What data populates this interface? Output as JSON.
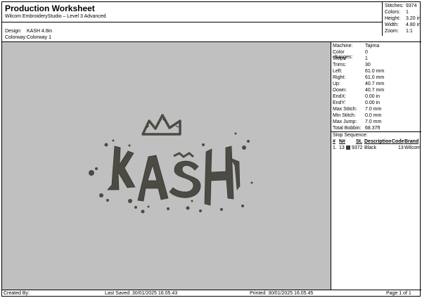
{
  "header": {
    "title": "Production Worksheet",
    "subtitle": "Wilcom EmbroideryStudio – Level 3 Advanced",
    "design_label": "Design:",
    "design_value": "KASH 4.8in",
    "colorway_label": "Colorway:",
    "colorway_value": "Colorway 1"
  },
  "top_stats": [
    {
      "label": "Stitches:",
      "value": "9374"
    },
    {
      "label": "Colors:",
      "value": "1"
    },
    {
      "label": "Height:",
      "value": "3.20 in"
    },
    {
      "label": "Width:",
      "value": "4.80 in"
    },
    {
      "label": "Zoom:",
      "value": "1:1"
    }
  ],
  "machine_info": [
    {
      "label": "Machine:",
      "value": "Tajima"
    },
    {
      "label": "Color changes:",
      "value": "0"
    },
    {
      "label": "Stops:",
      "value": "1"
    },
    {
      "label": "Trims:",
      "value": "30"
    },
    {
      "label": "Left:",
      "value": "61.0 mm"
    },
    {
      "label": "Right:",
      "value": "61.0 mm"
    },
    {
      "label": "Up:",
      "value": "40.7 mm"
    },
    {
      "label": "Down:",
      "value": "40.7 mm"
    },
    {
      "label": "EndX:",
      "value": "0.00 in"
    },
    {
      "label": "EndY:",
      "value": "0.00 in"
    },
    {
      "label": "Max Stitch:",
      "value": "7.0 mm"
    },
    {
      "label": "Min Stitch:",
      "value": "0.0 mm"
    },
    {
      "label": "Max Jump:",
      "value": "7.0 mm"
    },
    {
      "label": "Total Bobbin:",
      "value": "68.37ft"
    }
  ],
  "stop_sequence": {
    "title": "Stop Sequence:",
    "columns": [
      "#",
      "N#",
      "St.",
      "Description",
      "Code",
      "Brand"
    ],
    "rows": [
      {
        "num": "1.",
        "n": "13",
        "st": "9372",
        "description": "Black",
        "code": "13",
        "brand": "Wilcom",
        "color": "#3a3a3a"
      }
    ]
  },
  "design": {
    "text": "KASH",
    "background": "#c0c0c0",
    "thread_color": "#4b4a44"
  },
  "footer": {
    "created_by": "Created By:",
    "last_saved": "Last Saved: 30/01/2025 16.05.43",
    "printed": "Printed: 30/01/2025 16.05.45",
    "page": "Page 1 of 1"
  }
}
